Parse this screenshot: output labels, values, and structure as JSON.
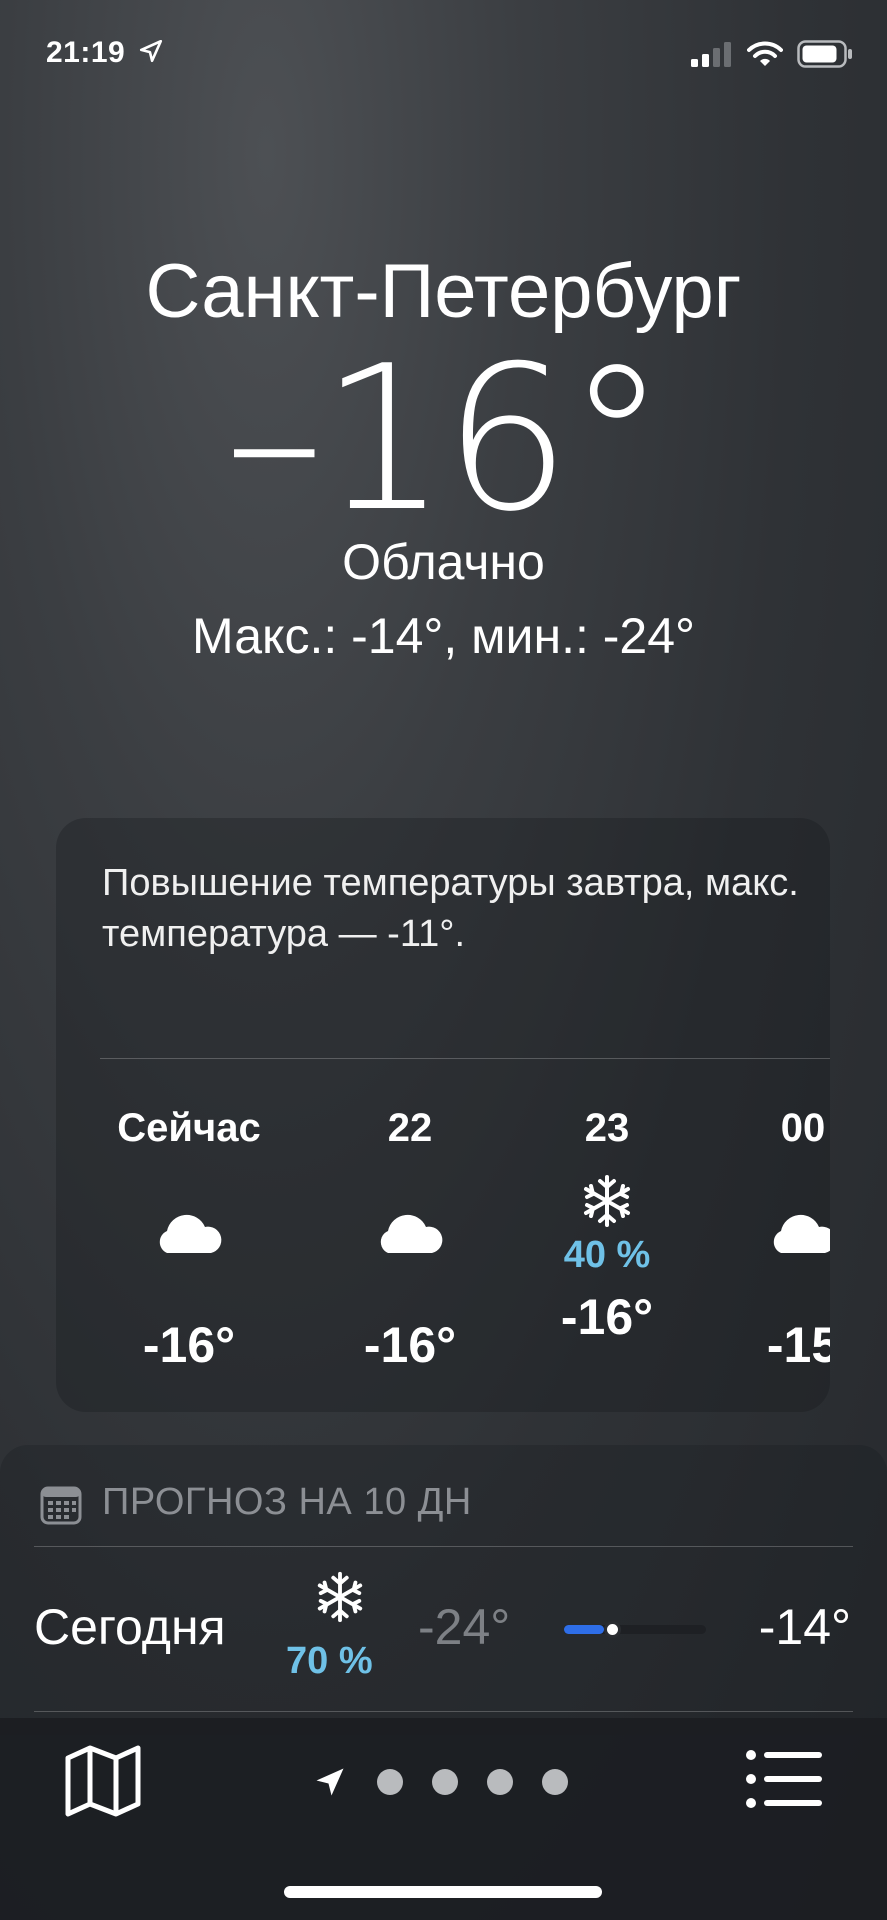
{
  "status_bar": {
    "time": "21:19",
    "icons": [
      "location-arrow-icon",
      "cellular-signal-icon",
      "wifi-icon",
      "battery-icon"
    ]
  },
  "current": {
    "city": "Санкт-Петербург",
    "temperature": "–16°",
    "condition": "Облачно",
    "hi_lo": "Макс.: -14°, мин.: -24°"
  },
  "hourly_card": {
    "summary": "Повышение температуры завтра, макс. температура — -11°.",
    "hours": [
      {
        "label": "Сейчас",
        "icon": "cloud-icon",
        "precip": "",
        "temp": "-16°"
      },
      {
        "label": "22",
        "icon": "cloud-icon",
        "precip": "",
        "temp": "-16°"
      },
      {
        "label": "23",
        "icon": "snowflake-icon",
        "precip": "40 %",
        "temp": "-16°"
      },
      {
        "label": "00",
        "icon": "cloud-icon",
        "precip": "",
        "temp": "-15"
      }
    ]
  },
  "daily": {
    "title": "ПРОГНОЗ НА 10 ДН",
    "title_icon": "calendar-icon",
    "today": {
      "label": "Сегодня",
      "icon": "snowflake-icon",
      "precip": "70 %",
      "low": "-24°",
      "high": "-14°",
      "range_fill": 0.28,
      "current_marker": 0.28
    }
  },
  "toolbar": {
    "left_icon": "map-icon",
    "right_icon": "list-icon",
    "page_indicator": [
      "location-arrow-icon",
      "dot",
      "dot",
      "dot",
      "dot"
    ]
  },
  "colors": {
    "precip_text": "#6fc1e7",
    "range_fill": "#2e6ee8",
    "muted_text": "#8c8f94"
  }
}
